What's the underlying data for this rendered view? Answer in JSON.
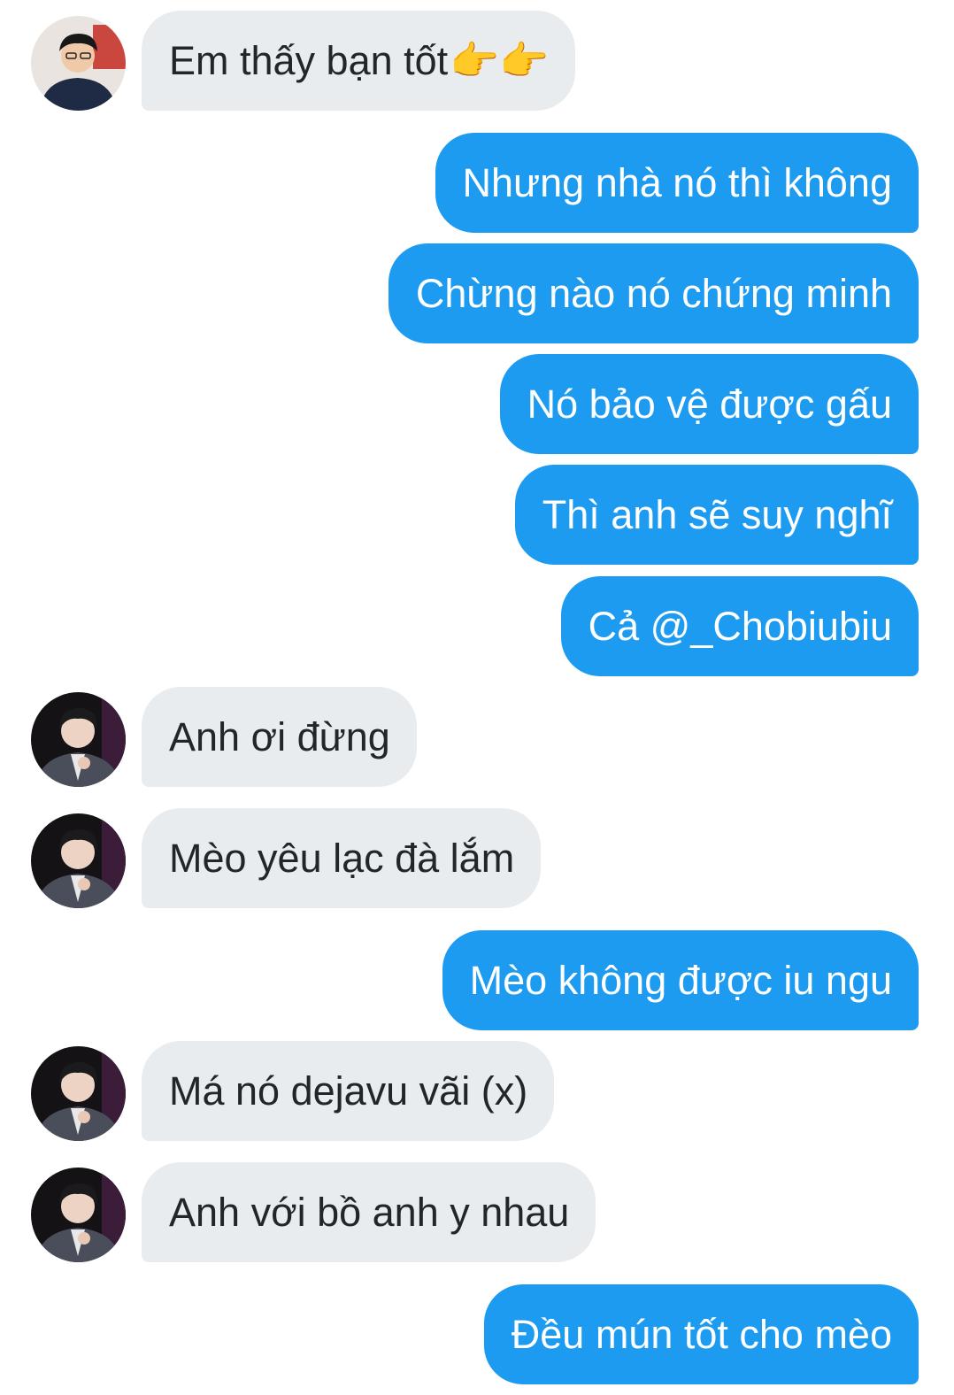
{
  "conversation": {
    "messages": [
      {
        "side": "in",
        "text": "Em thấy bạn tốt",
        "emoji": "👉👉",
        "avatar": "avatar-boy-icon"
      },
      {
        "side": "out",
        "text": "Nhưng nhà nó thì không"
      },
      {
        "side": "out",
        "text": "Chừng nào nó chứng minh"
      },
      {
        "side": "out",
        "text": "Nó bảo vệ được gấu"
      },
      {
        "side": "out",
        "text": "Thì anh sẽ suy nghĩ"
      },
      {
        "side": "out",
        "text": "Cả @_Chobiubiu"
      },
      {
        "side": "in",
        "text": "Anh ơi đừng",
        "avatar": "avatar-man-icon"
      },
      {
        "side": "in",
        "text": "Mèo yêu lạc đà lắm",
        "avatar": "avatar-man-icon"
      },
      {
        "side": "out",
        "text": "Mèo không được iu ngu"
      },
      {
        "side": "in",
        "text": "Má nó dejavu vãi (x)",
        "avatar": "avatar-man-icon"
      },
      {
        "side": "in",
        "text": "Anh với bồ anh y nhau",
        "avatar": "avatar-man-icon"
      },
      {
        "side": "out",
        "text": "Đều mún tốt cho mèo"
      }
    ]
  },
  "colors": {
    "incoming_bubble": "#e9ecef",
    "outgoing_bubble": "#1d9bf0",
    "incoming_text": "#22262b",
    "outgoing_text": "#ffffff"
  }
}
